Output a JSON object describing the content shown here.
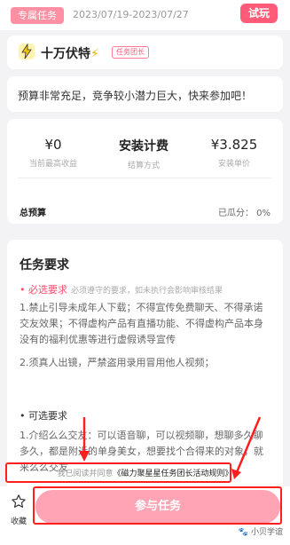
{
  "header": {
    "tag": "专属任务",
    "date_range": "2023/07/19-2023/07/27",
    "try_label": "试玩"
  },
  "app": {
    "name": "十万伏特",
    "name_suffix": "⚡",
    "badge": "任务团长",
    "logo_icon": "lightning-bunny-icon"
  },
  "description": "预算非常充足，竞争较小潜力巨大，快来参加吧！",
  "stats": {
    "income_value": "¥0",
    "income_label": "当前最高收益",
    "method_value": "安装计费",
    "method_label": "结算方式",
    "price_value": "¥3.825",
    "price_label": "安装单价",
    "budget_label": "总预算",
    "budget_value": "已瓜分： 0%"
  },
  "requirements": {
    "title": "任务要求",
    "must_title": "• 必选要求",
    "must_note": "必须遵守的要求，如未执行会影响审核结果",
    "must_items": [
      "1.禁止引导未成年人下载；不得宣传免费聊天、不得承诺交友效果；不得虚构产品有直播功能、不得虚构产品本身没有的福利优惠等进行虚假诱导宣传",
      "2.须真人出镜，严禁盗用录用冒用他人视频；"
    ],
    "optional_title": "• 可选要求",
    "optional_items": [
      "1.介绍么么交友：可以语音聊，可以视频聊，想聊多久聊多久，都是附近的单身美女，想要找个合得来的对象，就来么么交友"
    ]
  },
  "agreement": {
    "prefix": "我已阅读并同意",
    "link": "《磁力聚星星任务团长活动规则》"
  },
  "bottom": {
    "fav_icon": "star-outline-icon",
    "fav_label": "收藏",
    "join_label": "参与任务"
  },
  "watermark": "🐾 小贝学谊",
  "colors": {
    "accent": "#ff5a78",
    "button_disabled": "#ffa4b4",
    "annotation": "#ff1f1f"
  }
}
